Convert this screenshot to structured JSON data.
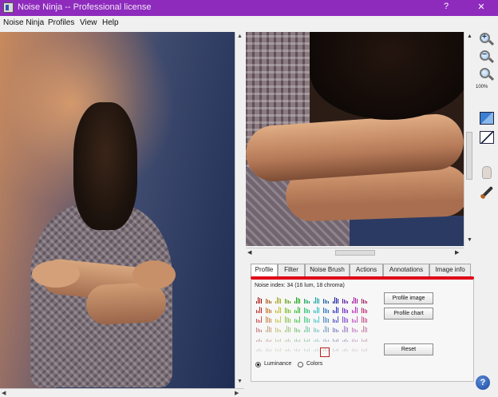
{
  "window": {
    "title": "Noise Ninja -- Professional license",
    "help_btn": "?",
    "close_btn": "✕"
  },
  "menu": [
    "Noise Ninja",
    "Profiles",
    "View",
    "Help"
  ],
  "tools": {
    "zoom_percent": "100%"
  },
  "tabs": [
    {
      "label": "Profile",
      "active": true
    },
    {
      "label": "Filter",
      "active": false
    },
    {
      "label": "Noise Brush",
      "active": false
    },
    {
      "label": "Actions",
      "active": false
    },
    {
      "label": "Annotations",
      "active": false
    },
    {
      "label": "Image info",
      "active": false
    }
  ],
  "profile": {
    "noise_index": "Noise index:  34 (16 lum, 18 chroma)",
    "buttons": {
      "profile_image": "Profile image",
      "profile_chart": "Profile chart",
      "reset": "Reset"
    },
    "radios": {
      "luminance": "Luminance",
      "colors": "Colors",
      "selected": "luminance"
    }
  },
  "help_icon": "?"
}
